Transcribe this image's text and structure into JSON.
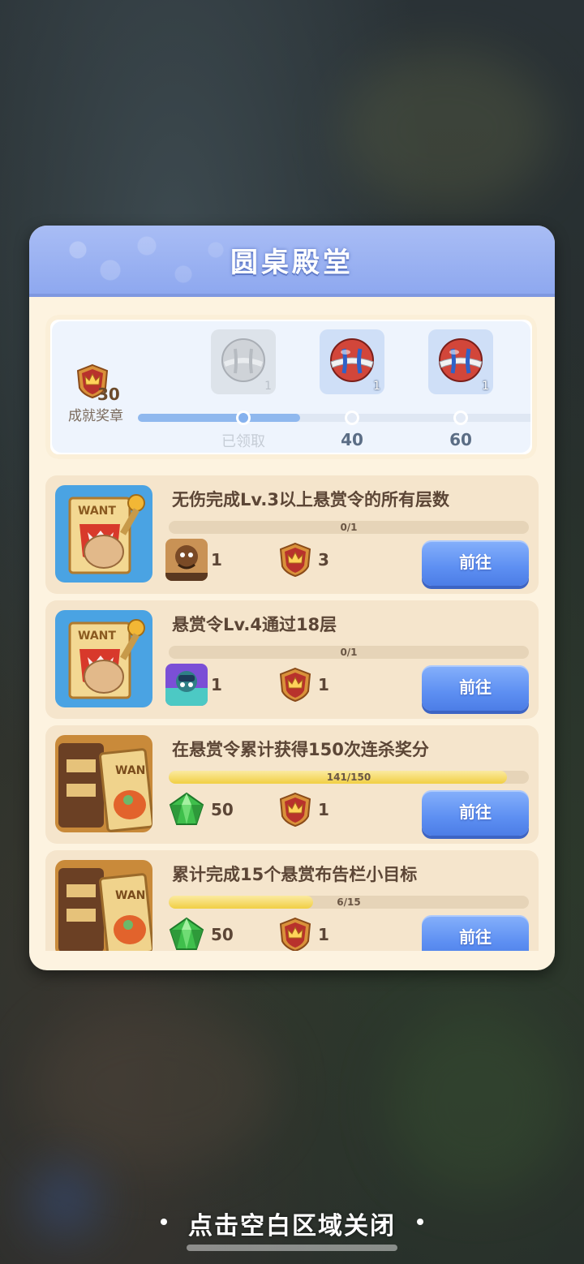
{
  "panel": {
    "title": "圆桌殿堂"
  },
  "achievement": {
    "medal_count": "30",
    "medal_label": "成就奖章",
    "progress_fraction": 0.4,
    "rewards": [
      {
        "qty": "1",
        "milestone": "已领取",
        "state": "claimed",
        "icon": "ball-icon"
      },
      {
        "qty": "1",
        "milestone": "40",
        "state": "locked",
        "icon": "ball-icon"
      },
      {
        "qty": "1",
        "milestone": "60",
        "state": "locked",
        "icon": "ball-icon"
      }
    ]
  },
  "tasks": [
    {
      "title": "无伤完成Lv.3以上悬赏令的所有层数",
      "progress_text": "0/1",
      "progress_fraction": 0,
      "icon": "wanted-poster-icon",
      "reward_item_icon": "hero-portrait-icon",
      "reward_item_amount": "1",
      "medal_amount": "3",
      "button_label": "前往"
    },
    {
      "title": "悬赏令Lv.4通过18层",
      "progress_text": "0/1",
      "progress_fraction": 0,
      "icon": "wanted-poster-icon",
      "reward_item_icon": "hero-portrait-icon",
      "reward_item_amount": "1",
      "medal_amount": "1",
      "button_label": "前往"
    },
    {
      "title": "在悬赏令累计获得150次连杀奖分",
      "progress_text": "141/150",
      "progress_fraction": 0.94,
      "icon": "wanted-board-icon",
      "reward_item_icon": "green-gem-icon",
      "reward_item_amount": "50",
      "medal_amount": "1",
      "button_label": "前往"
    },
    {
      "title": "累计完成15个悬赏布告栏小目标",
      "progress_text": "6/15",
      "progress_fraction": 0.4,
      "icon": "wanted-board-icon",
      "reward_item_icon": "green-gem-icon",
      "reward_item_amount": "50",
      "medal_amount": "1",
      "button_label": "前往"
    }
  ],
  "close_hint": "点击空白区域关闭",
  "colors": {
    "header": "#8ea8ef",
    "panel": "#fdf3e0",
    "task_bg": "#f5e5cc",
    "button": "#5d8ff2",
    "progress_fill": "#f1cf44"
  }
}
